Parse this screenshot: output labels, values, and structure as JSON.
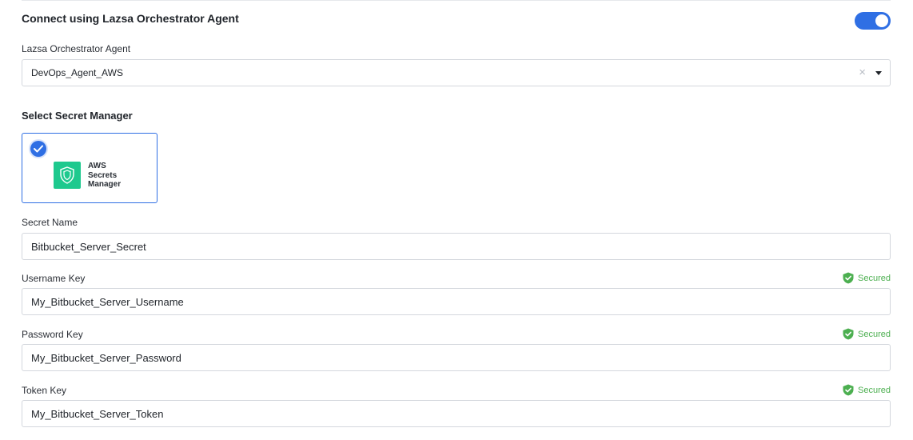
{
  "connect": {
    "title": "Connect using Lazsa Orchestrator Agent",
    "enabled": true
  },
  "agent": {
    "label": "Lazsa Orchestrator Agent",
    "value": "DevOps_Agent_AWS",
    "clear_symbol": "×"
  },
  "secret_manager": {
    "title": "Select Secret Manager",
    "options": [
      {
        "brand_line1": "AWS",
        "brand_line2": "Secrets",
        "brand_line3": "Manager",
        "selected": true
      }
    ]
  },
  "fields": {
    "secret_name": {
      "label": "Secret Name",
      "value": "Bitbucket_Server_Secret"
    },
    "username_key": {
      "label": "Username Key",
      "value": "My_Bitbucket_Server_Username",
      "status": "Secured"
    },
    "password_key": {
      "label": "Password Key",
      "value": "My_Bitbucket_Server_Password",
      "status": "Secured"
    },
    "token_key": {
      "label": "Token Key",
      "value": "My_Bitbucket_Server_Token",
      "status": "Secured"
    }
  },
  "colors": {
    "accent": "#2f6fe4",
    "secured": "#4caf50",
    "aws_logo": "#1ec98e"
  },
  "icons": {
    "check": "check-circle-icon",
    "shield": "shield-icon",
    "secured": "shield-check-icon",
    "caret": "caret-down-icon",
    "clear": "close-icon"
  }
}
